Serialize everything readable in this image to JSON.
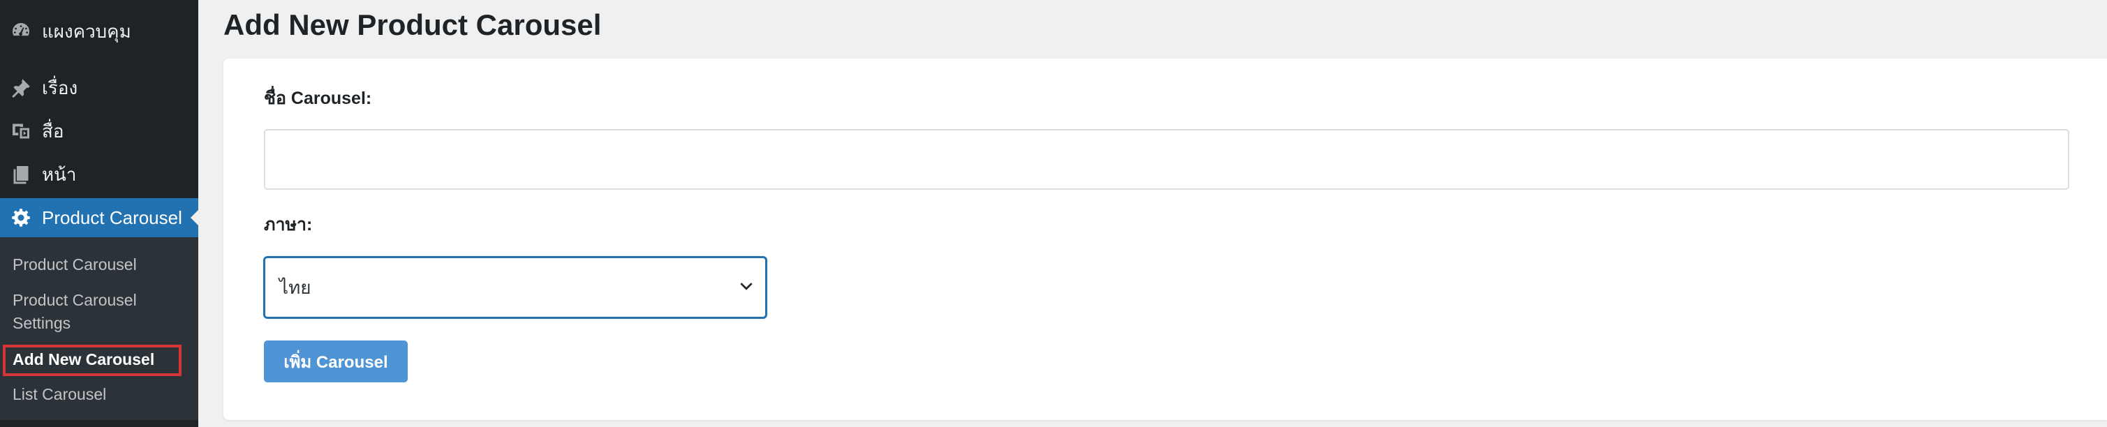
{
  "sidebar": {
    "menu": [
      {
        "label": "แผงควบคุม",
        "icon": "dashboard-icon"
      },
      {
        "label": "เรื่อง",
        "icon": "pushpin-icon"
      },
      {
        "label": "สื่อ",
        "icon": "media-icon"
      },
      {
        "label": "หน้า",
        "icon": "pages-icon"
      },
      {
        "label": "Product Carousel",
        "icon": "gear-icon",
        "active": true
      }
    ],
    "submenu": [
      {
        "label": "Product Carousel"
      },
      {
        "label": "Product Carousel"
      },
      {
        "label": "Settings"
      },
      {
        "label": "Add New Carousel",
        "current": true
      },
      {
        "label": "List Carousel"
      }
    ]
  },
  "page": {
    "title": "Add New Product Carousel"
  },
  "form": {
    "name_label": "ชื่อ Carousel:",
    "name_value": "",
    "language_label": "ภาษา:",
    "language_selected": "ไทย",
    "submit_label": "เพิ่ม Carousel"
  },
  "colors": {
    "sidebar_bg": "#1d2327",
    "submenu_bg": "#2c3338",
    "active_menu": "#2271b1",
    "button": "#4f94d4",
    "highlight_box": "#d63638"
  }
}
